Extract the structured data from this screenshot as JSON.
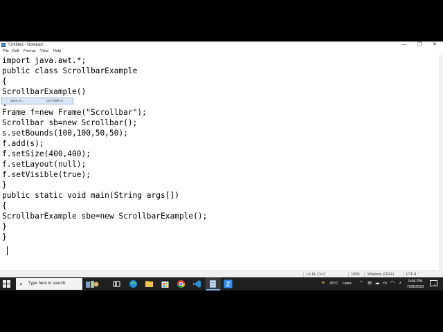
{
  "window": {
    "title": "*Untitled - Notepad",
    "minimize_glyph": "—",
    "maximize_glyph": "❐",
    "close_glyph": "✕"
  },
  "menu": [
    "File",
    "Edit",
    "Format",
    "View",
    "Help"
  ],
  "context_menu": {
    "label": "Save As...",
    "shortcut": "Ctrl+Shift+S"
  },
  "code_lines": [
    "import java.awt.*;",
    "public class ScrollbarExample",
    "{",
    "ScrollbarExample()",
    "{",
    "Frame f=new Frame(\"Scrollbar\");",
    "Scrollbar sb=new Scrollbar();",
    "s.setBounds(100,100,50,50);",
    "f.add(s);",
    "f.setSize(400,400);",
    "f.setLayout(null);",
    "f.setVisible(true);",
    "}",
    "public static void main(String args[])",
    "{",
    "ScrollbarExample sbe=new ScrollbarExample();",
    "}",
    "}"
  ],
  "status": {
    "position": "Ln 18, Col 2",
    "zoom": "100%",
    "line_ending": "Windows (CRLF)",
    "encoding": "UTF-8"
  },
  "taskbar": {
    "search_placeholder": "Type here to search",
    "weather_temp": "25°C",
    "weather_desc": "Haze",
    "time": "9:06 PM",
    "date": "7/28/2023",
    "notification_count": "2"
  },
  "colors": {
    "taskbar_bg": "#202020",
    "accent": "#0078d4",
    "selection": "#d9e6f5"
  }
}
